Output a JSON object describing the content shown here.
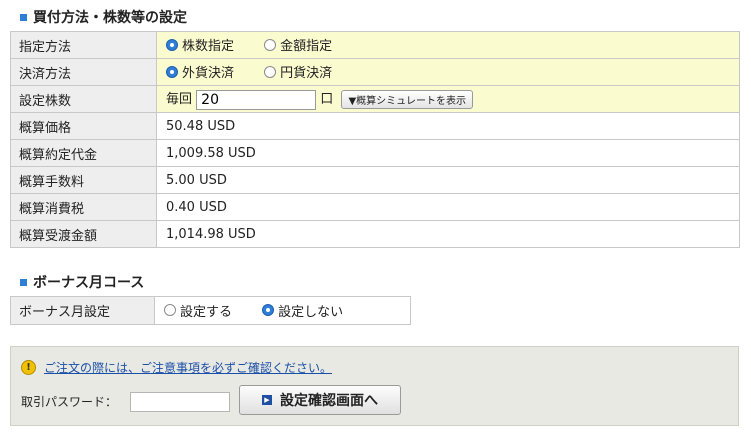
{
  "section1": {
    "title": "買付方法・株数等の設定",
    "rows": {
      "method": {
        "label": "指定方法",
        "opt1": "株数指定",
        "opt2": "金額指定"
      },
      "settlement": {
        "label": "決済方法",
        "opt1": "外貨決済",
        "opt2": "円貨決済"
      },
      "shares": {
        "label": "設定株数",
        "prefix": "毎回",
        "value": "20",
        "unit": "口",
        "sim_button": "▼概算シミュレートを表示"
      },
      "price": {
        "label": "概算価格",
        "value": "50.48 USD"
      },
      "contract": {
        "label": "概算約定代金",
        "value": "1,009.58 USD"
      },
      "fee": {
        "label": "概算手数料",
        "value": "5.00 USD"
      },
      "tax": {
        "label": "概算消費税",
        "value": "0.40 USD"
      },
      "total": {
        "label": "概算受渡金額",
        "value": "1,014.98 USD"
      }
    }
  },
  "section2": {
    "title": "ボーナス月コース",
    "label": "ボーナス月設定",
    "opt1": "設定する",
    "opt2": "設定しない"
  },
  "panel": {
    "notice": "ご注文の際には、ご注意事項を必ずご確認ください。",
    "password_label": "取引パスワード：",
    "submit": "設定確認画面へ"
  }
}
